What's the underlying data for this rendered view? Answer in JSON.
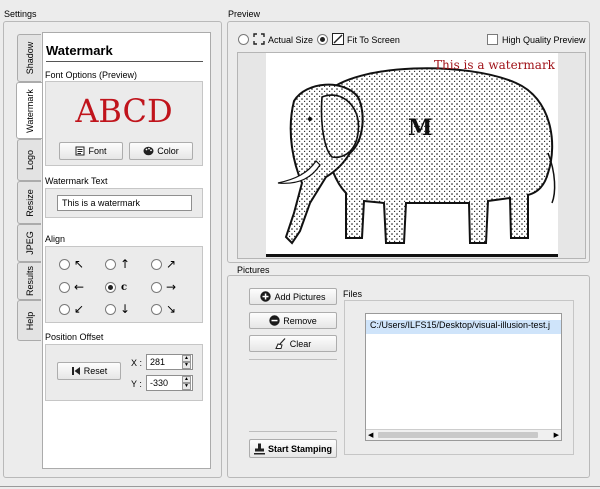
{
  "settings": {
    "title": "Settings"
  },
  "tabs": [
    "Shadow",
    "Watermark",
    "Logo",
    "Resize",
    "JPEG",
    "Results",
    "Help"
  ],
  "watermark": {
    "heading": "Watermark",
    "font_options_label": "Font Options (Preview)",
    "preview_text": "ABCD",
    "preview_color": "#c0141c",
    "font_button": "Font",
    "color_button": "Color",
    "text_label": "Watermark Text",
    "text_value": "This is a watermark",
    "align_label": "Align",
    "align_center_glyph": "c",
    "position_label": "Position Offset",
    "reset_button": "Reset",
    "x_label": "X :",
    "x_value": "281",
    "y_label": "Y :",
    "y_value": "-330"
  },
  "preview": {
    "title": "Preview",
    "actual_size": "Actual Size",
    "fit_to_screen": "Fit To Screen",
    "high_quality": "High Quality Preview",
    "watermark_overlay": "This is a watermark",
    "image_emblem": "M"
  },
  "pictures": {
    "title": "Pictures",
    "add_button": "Add Pictures",
    "remove_button": "Remove",
    "clear_button": "Clear",
    "files_label": "Files",
    "files": [
      "C:/Users/ILFS15/Desktop/visual-illusion-test.j"
    ],
    "start_button": "Start Stamping"
  }
}
